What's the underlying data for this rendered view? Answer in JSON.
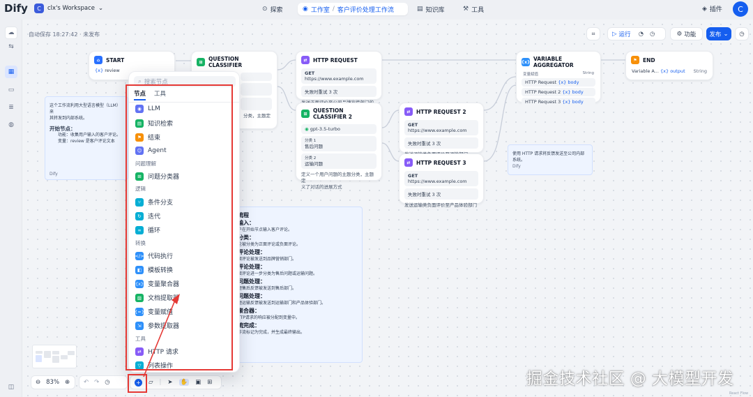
{
  "topbar": {
    "logo": "Dify",
    "workspace_initial": "C",
    "workspace_name": "clx's Workspace",
    "nav_explore": "探索",
    "nav_studio": "工作室",
    "nav_app": "客户评价处理工作流",
    "nav_knowledge": "知识库",
    "nav_tools": "工具",
    "plugins": "插件",
    "user_initial": "C"
  },
  "autosave": "自动保存 18:27:42 · 未发布",
  "actions": {
    "run": "运行",
    "features": "功能",
    "publish": "发布"
  },
  "nodes": {
    "start": {
      "title": "START",
      "var": "review"
    },
    "qc1": {
      "title": "QUESTION CLASSIFIER",
      "desc": "分类，主题定"
    },
    "http1": {
      "title": "HTTP REQUEST",
      "method": "GET",
      "url": "https://www.example.com",
      "retry": "失败时重试 3 次",
      "desc": "发送正面评价至公司品牌宣传部门的系"
    },
    "qc2": {
      "title": "QUESTION CLASSIFIER 2",
      "model": "gpt-3.5-turbo",
      "class1_label": "分类 1",
      "class1": "售后问题",
      "class2_label": "分类 2",
      "class2": "运输问题",
      "desc1": "定义一个用户问题的主题分类，主题定",
      "desc2": "义了对话的进展方式"
    },
    "http2": {
      "title": "HTTP REQUEST 2",
      "method": "GET",
      "url": "https://www.example.com",
      "retry": "失败时重试 3 次",
      "desc": "发送运输类负面评价至运输部门"
    },
    "http3": {
      "title": "HTTP REQUEST 3",
      "method": "GET",
      "url": "https://www.example.com",
      "retry": "失败时重试 3 次",
      "desc": "发送运输类负面评价至产品体验部门"
    },
    "agg": {
      "title": "VARIABLE AGGREGATOR",
      "label": "变量赋值",
      "type": "String",
      "r1": "HTTP Request",
      "r2": "HTTP Request 2",
      "r3": "HTTP Request 3",
      "body": "body"
    },
    "end": {
      "title": "END",
      "var_from": "Variable A...",
      "var": "output",
      "type": "String"
    }
  },
  "notes": {
    "left_line1": "这个工作流利用大型语言模型（LLM）来",
    "left_line2": "其转发到内部系统。",
    "left_head": "开始节点：",
    "left_func": "功能：收集用户输入的客户评论。",
    "left_var": "变量：review 是客户评论文本",
    "left_author": "Dify",
    "right_line1": "使用 HTTP 请求将反馈发送至公司内部",
    "right_line2": "系统。",
    "right_author": "Dify",
    "mid": [
      {
        "text": "流程",
        "head": true
      },
      {
        "text": "输入：",
        "head": true
      },
      {
        "text": "户在开始节点输入客户评论。",
        "head": false
      },
      {
        "text": "分类：",
        "head": true
      },
      {
        "text": "论被分类为正面评论或负面评论。",
        "head": false
      },
      {
        "text": "评论处理：",
        "head": true
      },
      {
        "text": "面评论被发送到品牌营销部门。",
        "head": false
      },
      {
        "text": "评论处理：",
        "head": true
      },
      {
        "text": "面评论进一步分类为售后问题或运输问题。",
        "head": false
      },
      {
        "text": "问题处理：",
        "head": true
      },
      {
        "text": "题售后反馈被发送到售后部门。",
        "head": false
      },
      {
        "text": "问题处理：",
        "head": true
      },
      {
        "text": "题运输反馈被发送到运输部门和产品体验部门。",
        "head": false
      },
      {
        "text": "聚合器：",
        "head": true
      },
      {
        "text": "TTP请求的响应被分配到变量中。",
        "head": false
      },
      {
        "text": "流完成：",
        "head": true
      },
      {
        "text": "作流标记为完成，并生成最终输出。",
        "head": false
      }
    ]
  },
  "popup": {
    "search_placeholder": "搜索节点",
    "tab_nodes": "节点",
    "tab_tools": "工具",
    "items": {
      "llm": "LLM",
      "knowledge": "知识检索",
      "end": "结束",
      "agent": "Agent",
      "g_understand": "问题理解",
      "classifier": "问题分类器",
      "g_logic": "逻辑",
      "ifelse": "条件分支",
      "iteration": "迭代",
      "loop": "循环",
      "g_transform": "转换",
      "code": "代码执行",
      "template": "模板转换",
      "aggregator": "变量聚合器",
      "doc": "文档提取器",
      "assigner": "变量赋值",
      "param": "参数提取器",
      "g_tools": "工具",
      "http": "HTTP 请求",
      "list": "列表操作"
    }
  },
  "zoom": "83%",
  "watermark": "掘金技术社区 @ 大模型开发",
  "react_flow": "React Flow"
}
